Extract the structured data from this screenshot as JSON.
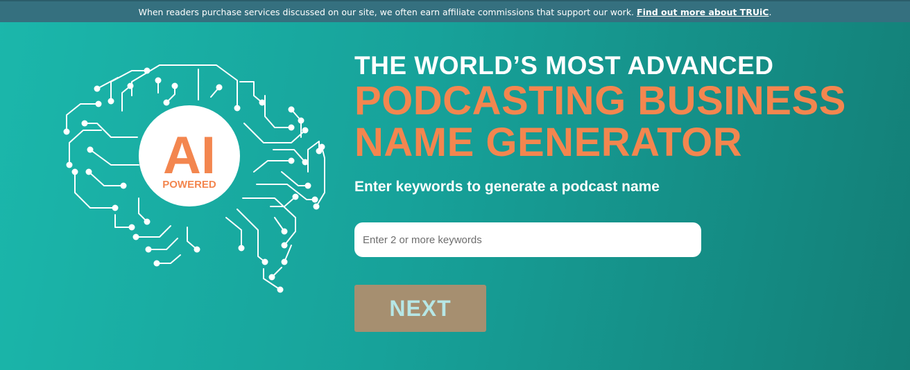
{
  "disclosure": {
    "text": "When readers purchase services discussed on our site, we often earn affiliate commissions that support our work.",
    "link_label": "Find out more about TRUiC",
    "period": "."
  },
  "badge": {
    "ai": "AI",
    "powered": "POWERED",
    "icon": "ai-brain-circuit-icon"
  },
  "headline": {
    "line1": "THE WORLD’S MOST ADVANCED",
    "line2": "PODCASTING BUSINESS",
    "line3": "NAME GENERATOR"
  },
  "subhead": "Enter keywords to generate a podcast name",
  "search": {
    "placeholder": "Enter 2 or more keywords",
    "value": ""
  },
  "next_button": "NEXT",
  "colors": {
    "accent": "#f3864f",
    "background_start": "#1bb7ab",
    "background_end": "#137f77",
    "banner": "#35707f",
    "button": "#a68f70",
    "button_text": "#b6e7e6"
  }
}
